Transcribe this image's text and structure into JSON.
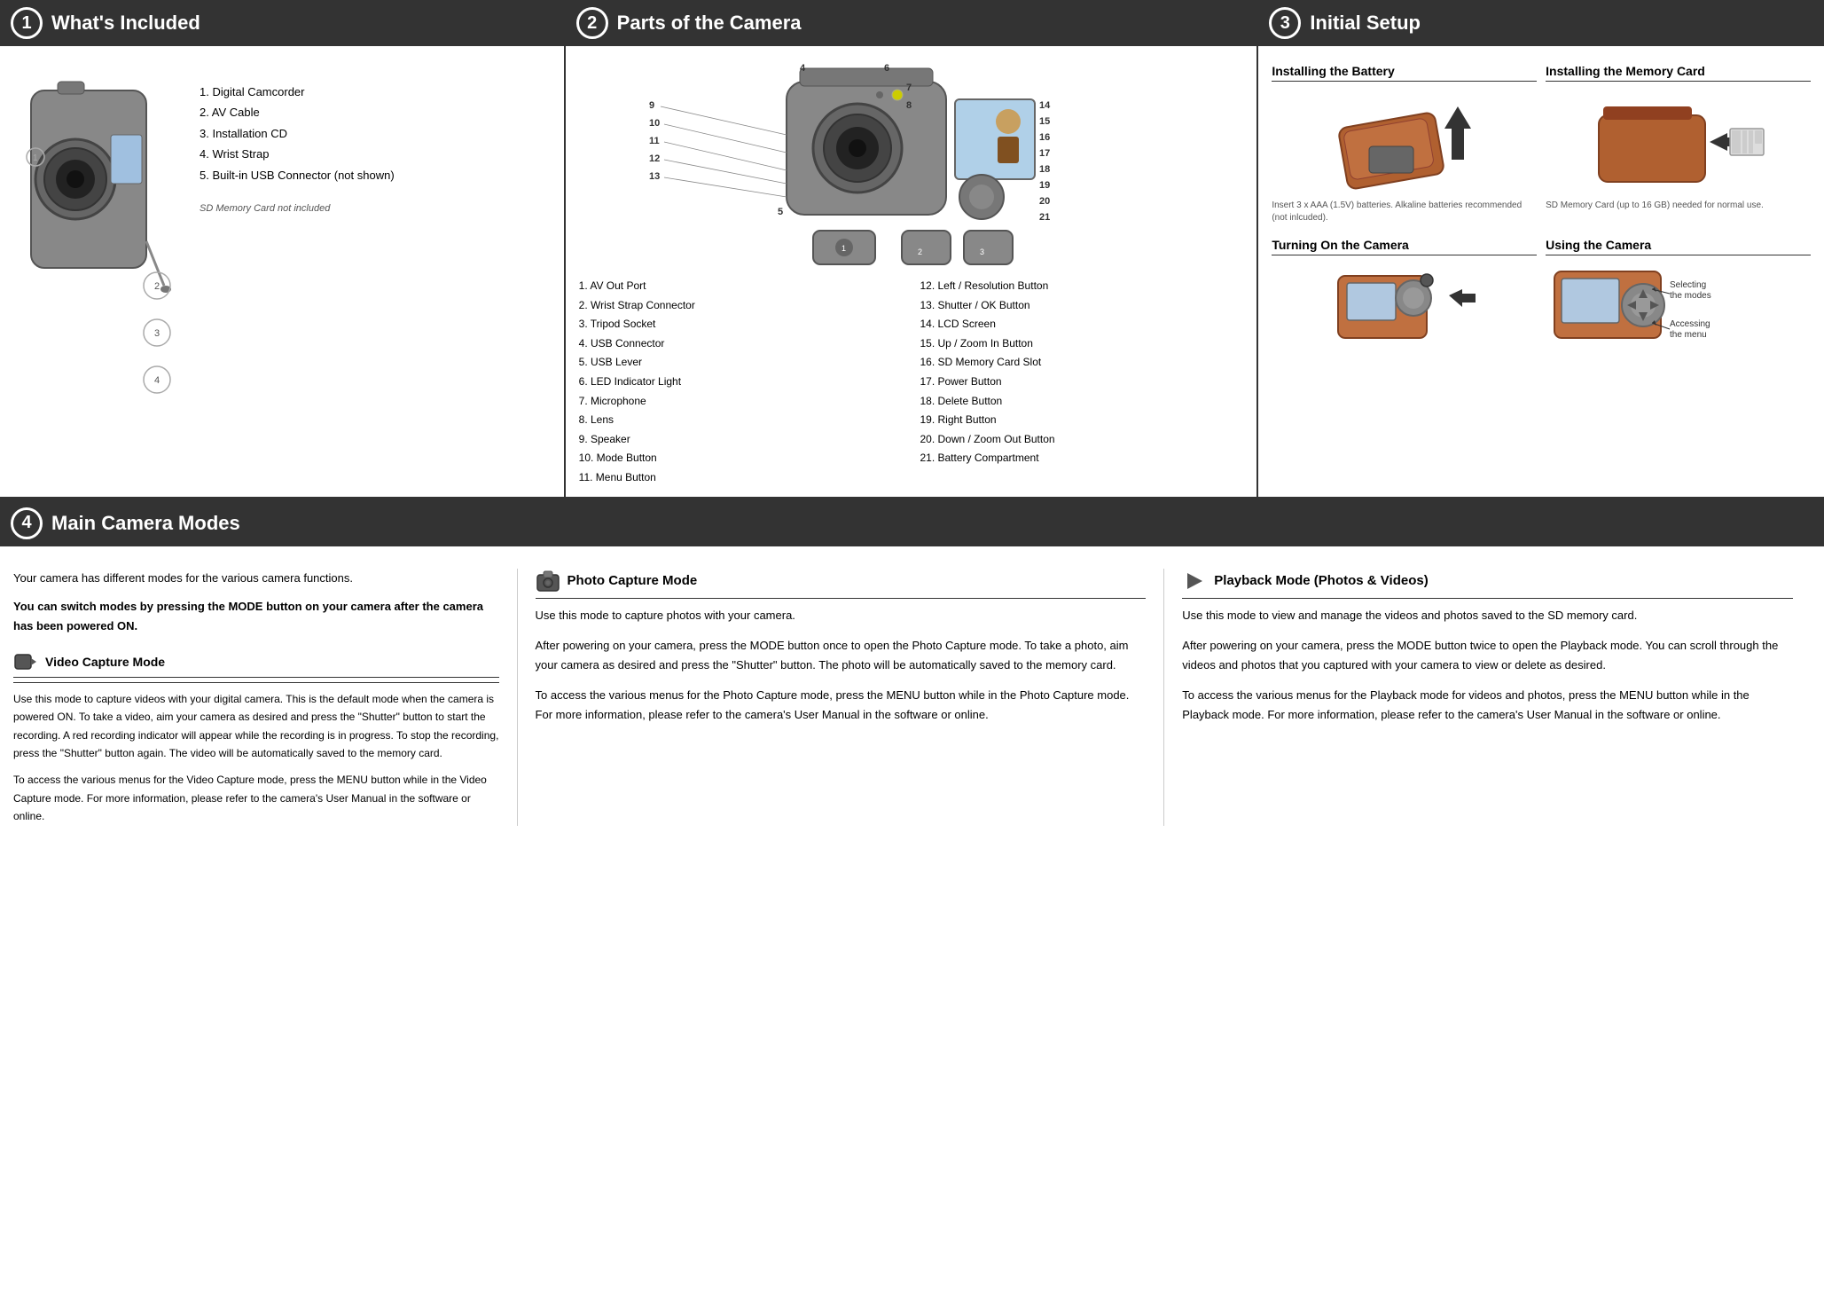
{
  "section1": {
    "number": "1",
    "title": "What's Included",
    "items": [
      "1.   Digital Camcorder",
      "2.   AV Cable",
      "3.   Installation CD",
      "4.   Wrist Strap",
      "5.   Built-in USB Connector (not shown)"
    ],
    "sd_note": "SD Memory Card not included"
  },
  "section2": {
    "number": "2",
    "title": "Parts of the Camera",
    "parts_left": [
      "1.   AV Out Port",
      "2.   Wrist Strap Connector",
      "3.   Tripod Socket",
      "4.   USB Connector",
      "5.   USB Lever",
      "6.   LED Indicator Light",
      "7.   Microphone",
      "8.   Lens",
      "9.   Speaker",
      "10. Mode Button",
      "11. Menu Button"
    ],
    "parts_right": [
      "12. Left / Resolution Button",
      "13. Shutter / OK Button",
      "14. LCD Screen",
      "15. Up / Zoom In Button",
      "16. SD Memory Card Slot",
      "17. Power Button",
      "18. Delete Button",
      "19. Right Button",
      "20. Down / Zoom Out Button",
      "21. Battery Compartment"
    ]
  },
  "section3": {
    "number": "3",
    "title": "Initial Setup",
    "battery_header": "Installing the Battery",
    "battery_text": "Insert 3 x AAA (1.5V) batteries. Alkaline batteries recommended (not inlcuded).",
    "memcard_header": "Installing the Memory Card",
    "memcard_note": "SD Memory Card (up to 16 GB) needed for normal use.",
    "turning_header": "Turning On the Camera",
    "using_header": "Using the Camera",
    "selecting_modes": "Selecting the modes",
    "accessing_menu": "Accessing the menu"
  },
  "section4": {
    "number": "4",
    "title": "Main Camera Modes",
    "intro_text1": "Your  camera  has  different  modes  for  the  various  camera functions.",
    "intro_text2": "You can switch modes by pressing the MODE button on your camera after the camera has been powered ON.",
    "video_header": "Video Capture Mode",
    "video_text1": "Use this mode to capture videos with your digital camera. This is the default mode when the camera is powered ON. To take a video, aim your camera as desired and press the \"Shutter\" button to start the recording. A red recording indicator will appear while the recording is in progress. To stop the recording, press the \"Shutter\" button again. The video will be automatically saved to the memory card.",
    "video_text2": "To access the various menus for the Video Capture mode, press the MENU button while in the Video Capture mode. For more information, please refer to the camera's User Manual in the software or online.",
    "photo_header": "Photo Capture Mode",
    "photo_text1": "Use this mode to capture photos with your camera.",
    "photo_text2": "After powering on your camera, press the MODE button once to open the Photo Capture mode. To take a photo, aim your camera as desired and press the \"Shutter\" button. The photo will be automatically saved to the memory card.",
    "photo_text3": "To access the various menus for the Photo Capture mode, press the MENU button while in the Photo Capture mode. For more information,  please  refer  to  the  camera's  User  Manual  in  the software or online.",
    "playback_header": "Playback Mode (Photos & Videos)",
    "playback_text1": "Use this mode to view and manage the videos and photos saved to the SD memory card.",
    "playback_text2": "After powering on your camera, press the MODE button twice to open the Playback mode. You can scroll through the videos and photos that you captured with your camera to view or delete as desired.",
    "playback_text3": "To access the various menus for the Playback mode for videos and photos, press the MENU button while in the Playback mode. For more information, please refer to the camera's User Manual in the software or online."
  }
}
